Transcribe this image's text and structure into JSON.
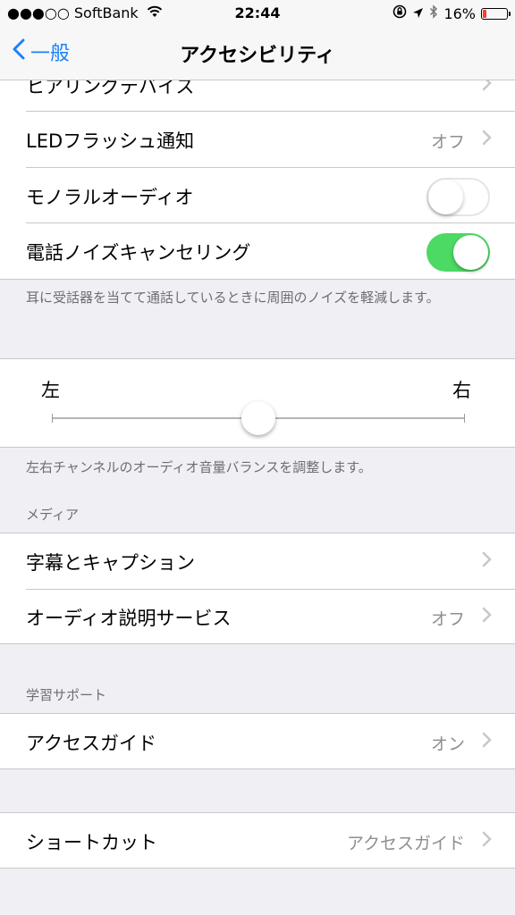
{
  "status_bar": {
    "carrier": "●●●○○ SoftBank",
    "time": "22:44",
    "battery_percent": "16%",
    "battery_level": 0.16,
    "icons": [
      "wifi-icon",
      "rotation-lock-icon",
      "location-icon",
      "bluetooth-icon",
      "battery-icon"
    ]
  },
  "nav": {
    "back_label": "一般",
    "title": "アクセシビリティ"
  },
  "hearing": {
    "partial_row": "ヒアリングデバイス",
    "led_label": "LEDフラッシュ通知",
    "led_value": "オフ",
    "mono_label": "モノラルオーディオ",
    "mono_on": false,
    "noise_label": "電話ノイズキャンセリング",
    "noise_on": true,
    "noise_footer": "耳に受話器を当てて通話しているときに周囲のノイズを軽減します。"
  },
  "balance": {
    "left_label": "左",
    "right_label": "右",
    "value": 0.5,
    "footer": "左右チャンネルのオーディオ音量バランスを調整します。"
  },
  "media": {
    "header": "メディア",
    "subtitles_label": "字幕とキャプション",
    "audio_desc_label": "オーディオ説明サービス",
    "audio_desc_value": "オフ"
  },
  "learning": {
    "header": "学習サポート",
    "guided_label": "アクセスガイド",
    "guided_value": "オン"
  },
  "shortcut": {
    "label": "ショートカット",
    "value": "アクセスガイド"
  },
  "colors": {
    "accent": "#1a82fb",
    "toggle_on": "#4cd964",
    "battery_low": "#ff3b30"
  }
}
